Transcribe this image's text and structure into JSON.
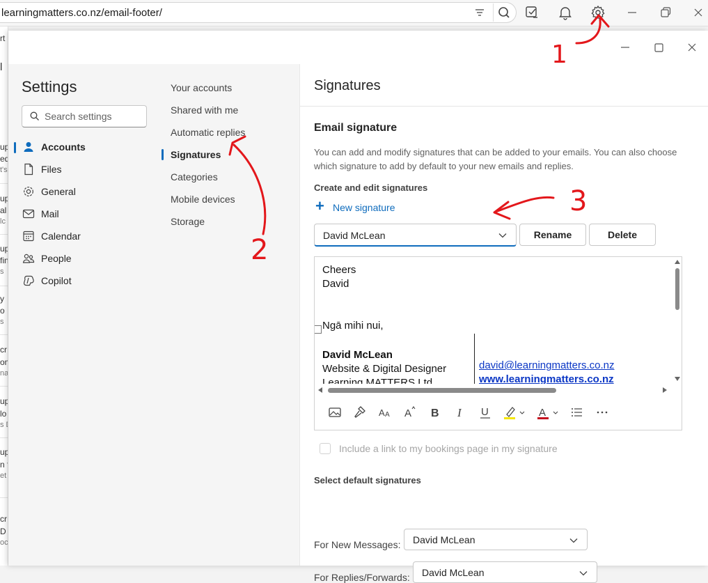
{
  "browser": {
    "url": "learningmatters.co.nz/email-footer/",
    "icons": [
      "filter-icon",
      "search-icon",
      "collections-icon",
      "notifications-icon",
      "settings-gear-icon",
      "minimize-icon",
      "restore-icon",
      "close-icon"
    ]
  },
  "background_page": {
    "fragments": [
      "rt",
      "l",
      "up",
      "ed",
      "t's",
      "up",
      "al",
      "lc",
      "up",
      "fin",
      "s",
      "y",
      "o",
      "s",
      "cr",
      "om",
      "na",
      "up",
      "lo",
      "s D",
      "up",
      "n f",
      "et",
      "cr",
      "D",
      "oc"
    ]
  },
  "settings": {
    "title": "Settings",
    "search_placeholder": "Search settings",
    "nav": [
      {
        "label": "Accounts",
        "icon": "person-icon",
        "active": true
      },
      {
        "label": "Files",
        "icon": "file-icon",
        "active": false
      },
      {
        "label": "General",
        "icon": "gear-icon",
        "active": false
      },
      {
        "label": "Mail",
        "icon": "mail-icon",
        "active": false
      },
      {
        "label": "Calendar",
        "icon": "calendar-icon",
        "active": false
      },
      {
        "label": "People",
        "icon": "people-icon",
        "active": false
      },
      {
        "label": "Copilot",
        "icon": "copilot-icon",
        "active": false
      }
    ],
    "sub_nav": [
      {
        "label": "Your accounts",
        "active": false
      },
      {
        "label": "Shared with me",
        "active": false
      },
      {
        "label": "Automatic replies",
        "active": false
      },
      {
        "label": "Signatures",
        "active": true
      },
      {
        "label": "Categories",
        "active": false
      },
      {
        "label": "Mobile devices",
        "active": false
      },
      {
        "label": "Storage",
        "active": false
      }
    ]
  },
  "signatures": {
    "title": "Signatures",
    "section_title": "Email signature",
    "description": "You can add and modify signatures that can be added to your emails. You can also choose which signature to add by default to your new emails and replies.",
    "create_edit_label": "Create and edit signatures",
    "new_signature_label": "New signature",
    "selected_signature": "David McLean",
    "rename_label": "Rename",
    "delete_label": "Delete",
    "editor": {
      "lines": [
        "Cheers",
        "David",
        "Ngā mihi nui,",
        "David McLean",
        "Website & Digital Designer",
        "Learning MATTERS Ltd"
      ],
      "email_link": "david@learningmatters.co.nz",
      "web_link": "www.learningmatters.co.nz"
    },
    "format_toolbar": [
      "image-icon",
      "format-painter-icon",
      "font-size-icon",
      "grow-font-icon",
      "bold-icon",
      "italic-icon",
      "underline-icon",
      "highlight-icon",
      "font-color-icon",
      "bullets-icon",
      "more-icon"
    ],
    "bookings_label": "Include a link to my bookings page in my signature",
    "default_section_title": "Select default signatures",
    "new_messages_label": "For New Messages:",
    "new_messages_value": "David McLean",
    "replies_label": "For Replies/Forwards:",
    "replies_value": "David McLean"
  },
  "annotations": [
    "1",
    "2",
    "3"
  ],
  "colors": {
    "accent": "#0f6cbd",
    "annotation": "#e3171b",
    "link": "#0b37c5"
  }
}
